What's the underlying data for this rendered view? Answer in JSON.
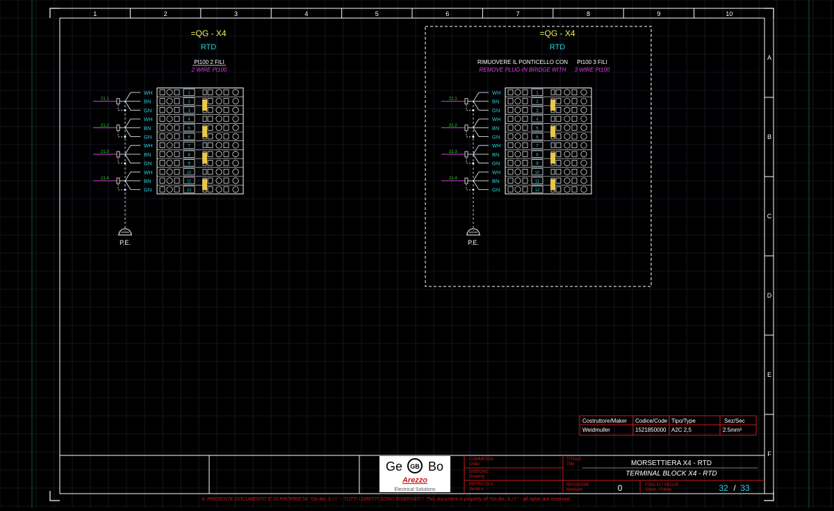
{
  "colors": {
    "background": "#000000",
    "grid": "#1e2a3c",
    "frame": "#ffffff",
    "yellow": "#f0f05a",
    "cyan": "#29d3e6",
    "magenta": "#e040e0",
    "green": "#38d038",
    "red": "#d01818",
    "jumper": "#e8c84a"
  },
  "columns": [
    "1",
    "2",
    "3",
    "4",
    "5",
    "6",
    "7",
    "8",
    "9",
    "10"
  ],
  "rows": [
    "A",
    "B",
    "C",
    "D",
    "E",
    "F"
  ],
  "left_block": {
    "title": "=QG - X4",
    "subtitle": "RTD",
    "note_line1": "Pt100 2 FILI",
    "note_line2": "2 WIRE Pt100",
    "pe_label": "P.E."
  },
  "right_block": {
    "title": "=QG - X4",
    "subtitle": "RTD",
    "note_a_line1": "RIMUOVERE IL PONTICELLO CON",
    "note_a_line2": "REMOVE PLUG-IN BRIDGE WITH",
    "note_b_line1": "Pt100 3 FILI",
    "note_b_line2": "3 WIRE Pt100",
    "pe_label": "P.E."
  },
  "sensors": [
    "21.1",
    "21.2",
    "21.3",
    "21.4"
  ],
  "wire_colors": [
    "WH",
    "BN",
    "GN",
    "WH",
    "BN",
    "GN",
    "WH",
    "BN",
    "GN",
    "WH",
    "BN",
    "GN"
  ],
  "terminals": [
    "1",
    "2",
    "3",
    "4",
    "5",
    "6",
    "7",
    "8",
    "9",
    "10",
    "11",
    "12"
  ],
  "parts_table": {
    "headers": [
      "Costruttore/Maker",
      "Codice/Code",
      "Tipo/Type",
      "Sez/Sec"
    ],
    "row": [
      "Weidmuller",
      "1521850000",
      "A2C 2,5",
      "2.5mm²"
    ]
  },
  "title_block": {
    "logo_left": "Ge",
    "logo_mark": "GB",
    "logo_right": "Bo",
    "logo_city": "Arezzo",
    "logo_tagline": "Electrical Solutions",
    "commessa_it": "COMMESSA",
    "commessa_en": "Order",
    "disegno_it": "DISEGNO",
    "disegno_en": "Drawing",
    "matricola_it": "MATRICOLA",
    "matricola_en": "Serial n.",
    "titolo_it": "TITOLO",
    "titolo_en": "Title",
    "title_line1": "MORSETTIERA X4 - RTD",
    "title_line2": "TERMINAL BLOCK X4 - RTD",
    "revisione_it": "REVISIONE",
    "revisione_en": "Revision",
    "revision_value": "0",
    "foglio_it": "FOGLIO / SEGUE",
    "foglio_en": "Sheet / Follow",
    "sheet_current": "32",
    "sheet_separator": "/",
    "sheet_total": "33"
  },
  "footer": {
    "copyright_it": "IL PRESENTE DOCUMENTO E' DI PROPRIETA' \"Ge.Bo. S.r.l.\" - TUTTI I DIRITTI SONO RISERVATI /",
    "copyright_en": "This document is property of \"Ge.Bo. S.r.l.\" - all rights are reserved"
  }
}
